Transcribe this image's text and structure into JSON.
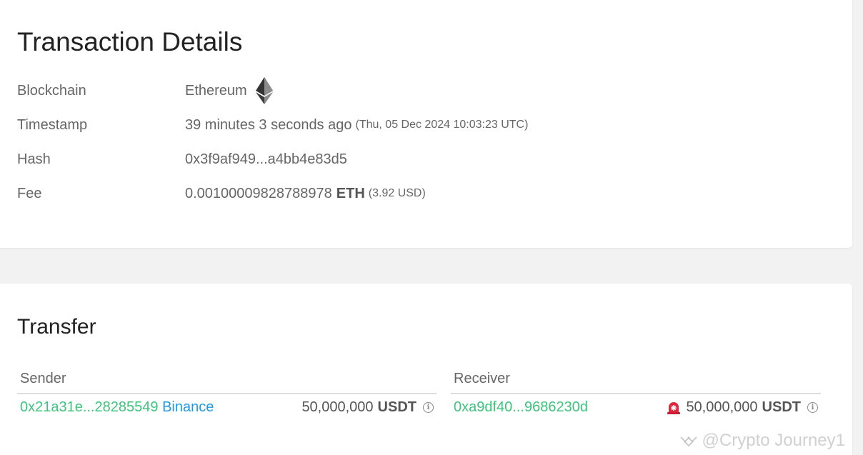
{
  "details": {
    "title": "Transaction Details",
    "rows": [
      {
        "label": "Blockchain",
        "value": "Ethereum",
        "icon": "ethereum-icon"
      },
      {
        "label": "Timestamp",
        "value": "39 minutes 3 seconds ago",
        "extra": "(Thu, 05 Dec 2024 10:03:23 UTC)"
      },
      {
        "label": "Hash",
        "value": "0x3f9af949...a4bb4e83d5"
      },
      {
        "label": "Fee",
        "value": "0.00100009828788978",
        "unit": "ETH",
        "extra": "(3.92 USD)"
      }
    ]
  },
  "transfer": {
    "title": "Transfer",
    "sender": {
      "header": "Sender",
      "address": "0x21a31e...28285549",
      "tag": "Binance",
      "amount": "50,000,000",
      "unit": "USDT",
      "info_icon": "info-icon"
    },
    "receiver": {
      "header": "Receiver",
      "address": "0xa9df40...9686230d",
      "alert_icon": "siren-alarm-icon",
      "amount": "50,000,000",
      "unit": "USDT",
      "info_icon": "info-icon"
    }
  },
  "watermark": {
    "text": "@Crypto Journey1",
    "icon": "binance-square-icon"
  },
  "colors": {
    "link_green": "#3cc47c",
    "link_blue": "#1a9be6",
    "alert_red": "#e0263d"
  }
}
